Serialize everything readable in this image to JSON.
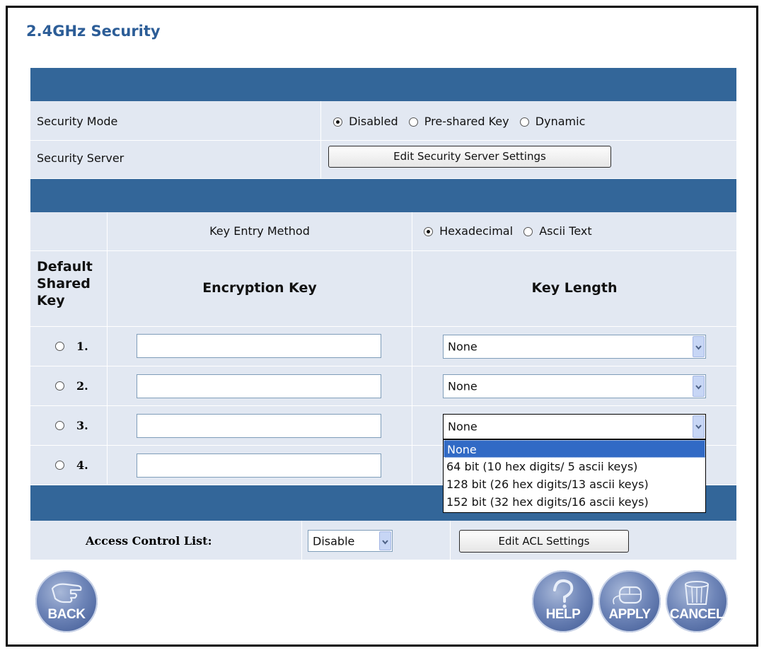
{
  "page": {
    "title": "2.4GHz Security"
  },
  "security": {
    "mode_label": "Security Mode",
    "modes": [
      {
        "label": "Disabled",
        "selected": true
      },
      {
        "label": "Pre-shared Key",
        "selected": false
      },
      {
        "label": "Dynamic",
        "selected": false
      }
    ],
    "server_label": "Security Server",
    "server_button": "Edit Security Server Settings"
  },
  "keys": {
    "entry_method_label": "Key Entry Method",
    "entry_methods": [
      {
        "label": "Hexadecimal",
        "selected": true
      },
      {
        "label": "Ascii Text",
        "selected": false
      }
    ],
    "col_default": "Default Shared Key",
    "col_default_lines": [
      "Default",
      "Shared",
      "Key"
    ],
    "col_encryption": "Encryption Key",
    "col_length": "Key Length",
    "rows": [
      {
        "num": "1.",
        "value": "",
        "length": "None"
      },
      {
        "num": "2.",
        "value": "",
        "length": "None"
      },
      {
        "num": "3.",
        "value": "",
        "length": "None"
      },
      {
        "num": "4.",
        "value": ""
      }
    ],
    "length_options": [
      "None",
      "64 bit (10 hex digits/ 5 ascii keys)",
      "128 bit (26 hex digits/13 ascii keys)",
      "152 bit (32 hex digits/16 ascii keys)"
    ]
  },
  "acl": {
    "label": "Access Control List:",
    "value": "Disable",
    "button": "Edit ACL Settings"
  },
  "nav": {
    "back": "BACK",
    "help": "HELP",
    "apply": "APPLY",
    "cancel": "CANCEL"
  },
  "colors": {
    "band": "#336699",
    "row": "#e2e8f2",
    "title": "#2c5d97",
    "selected_option": "#316ac5"
  }
}
